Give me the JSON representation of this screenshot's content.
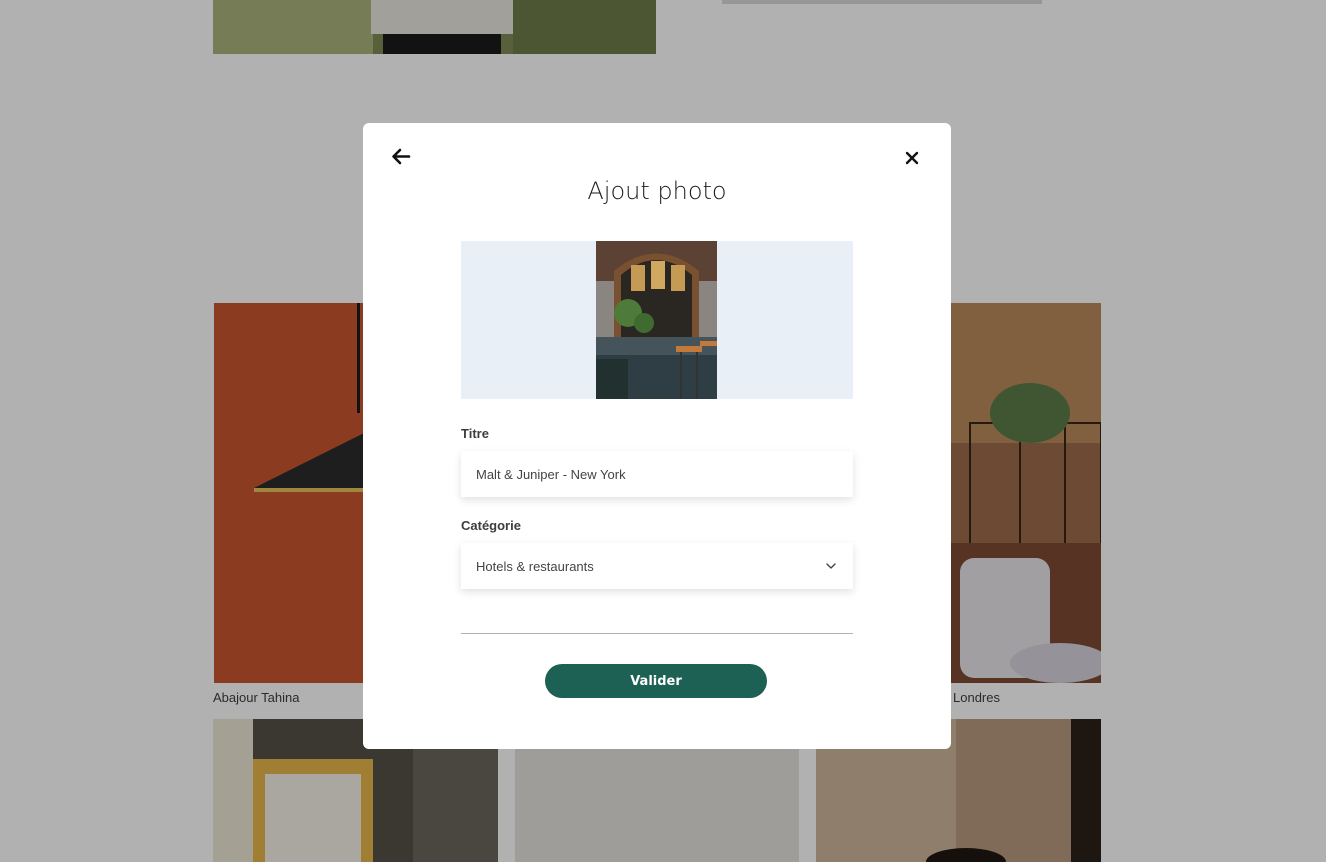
{
  "gallery": {
    "captions": [
      "Abajour Tahina",
      "Londres"
    ],
    "colors": {
      "modal_overlay_bg": "#b2b1ad",
      "accent": "#1d6154"
    }
  },
  "modal": {
    "title": "Ajout photo",
    "back_icon": "arrow-left-icon",
    "close_icon": "close-icon",
    "preview_alt": "Malt & Juniper - New York",
    "title_label": "Titre",
    "title_value": "Malt & Juniper - New York",
    "category_label": "Catégorie",
    "category_value": "Hotels & restaurants",
    "category_icon": "chevron-down-icon",
    "submit_label": "Valider"
  }
}
